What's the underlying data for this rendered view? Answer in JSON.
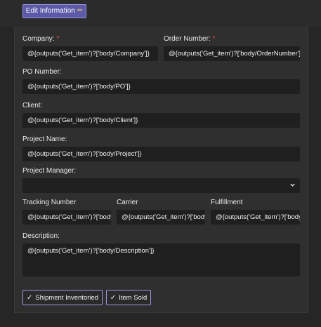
{
  "header": {
    "edit_label": "Edit Information"
  },
  "form": {
    "company": {
      "label": "Company:",
      "required": "*",
      "value": "@{outputs('Get_item')?['body/Company']}"
    },
    "order_number": {
      "label": "Order Number:",
      "required": "*",
      "value": "@{outputs('Get_item')?['body/OrderNumber']}"
    },
    "po_number": {
      "label": "PO Number:",
      "value": "@{outputs('Get_item')?['body/PO']}"
    },
    "client": {
      "label": "Client:",
      "value": "@{outputs('Get_item')?['body/Client']}"
    },
    "project_name": {
      "label": "Project Name:",
      "value": "@{outputs('Get_item')?['body/Project']}"
    },
    "project_manager": {
      "label": "Project Manager:",
      "value": ""
    },
    "tracking_number": {
      "label": "Tracking Number",
      "value": "@{outputs('Get_item')?['body/Tracking']}"
    },
    "carrier": {
      "label": "Carrier",
      "value": "@{outputs('Get_item')?['body/Carrier']}"
    },
    "fulfillment": {
      "label": "Fulfillment",
      "value": "@{outputs('Get_item')?['body/Fulfillment']}"
    },
    "description": {
      "label": "Description:",
      "value": "@{outputs('Get_item')?['body/Description']}"
    }
  },
  "actions": {
    "shipment_inventoried": "Shipment Inventoried",
    "item_sold": "Item Sold"
  },
  "icons": {
    "edit": "pencil-icon",
    "select": "chevron-down-icon",
    "check": "check-icon"
  },
  "colors": {
    "accent": "#5c59a8",
    "accent_border": "#9a97e0",
    "required": "#e0524f"
  }
}
